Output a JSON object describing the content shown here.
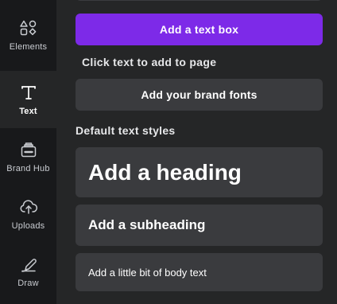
{
  "sidebar": {
    "items": [
      {
        "label": "Elements",
        "icon": "elements-icon",
        "active": false
      },
      {
        "label": "Text",
        "icon": "text-icon",
        "active": true
      },
      {
        "label": "Brand Hub",
        "icon": "brand-hub-icon",
        "active": false
      },
      {
        "label": "Uploads",
        "icon": "uploads-icon",
        "active": false
      },
      {
        "label": "Draw",
        "icon": "draw-icon",
        "active": false
      }
    ]
  },
  "panel": {
    "add_text_box_label": "Add a text box",
    "click_hint": "Click text to add to page",
    "brand_fonts_label": "Add your brand fonts",
    "default_styles_title": "Default text styles",
    "styles": {
      "heading": "Add a heading",
      "subheading": "Add a subheading",
      "body": "Add a little bit of body text"
    }
  },
  "colors": {
    "accent": "#7d2ae8",
    "panel_bg": "#252627",
    "sidebar_bg": "#18191b",
    "card_bg": "#3a3b3e"
  }
}
